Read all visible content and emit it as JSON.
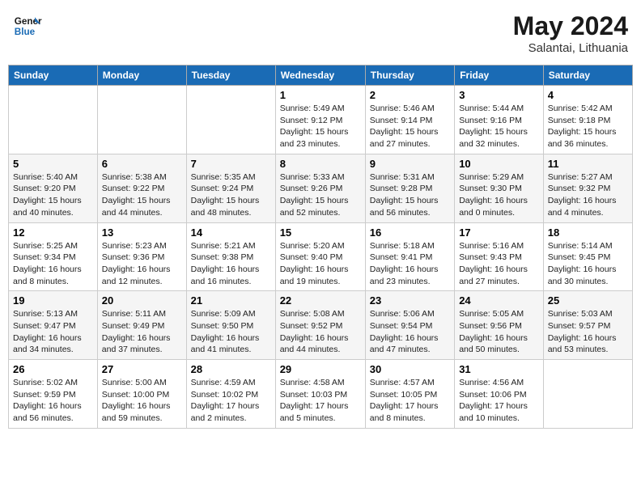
{
  "logo": {
    "line1": "General",
    "line2": "Blue"
  },
  "title": "May 2024",
  "location": "Salantai, Lithuania",
  "days_header": [
    "Sunday",
    "Monday",
    "Tuesday",
    "Wednesday",
    "Thursday",
    "Friday",
    "Saturday"
  ],
  "weeks": [
    [
      {
        "day": "",
        "info": ""
      },
      {
        "day": "",
        "info": ""
      },
      {
        "day": "",
        "info": ""
      },
      {
        "day": "1",
        "info": "Sunrise: 5:49 AM\nSunset: 9:12 PM\nDaylight: 15 hours\nand 23 minutes."
      },
      {
        "day": "2",
        "info": "Sunrise: 5:46 AM\nSunset: 9:14 PM\nDaylight: 15 hours\nand 27 minutes."
      },
      {
        "day": "3",
        "info": "Sunrise: 5:44 AM\nSunset: 9:16 PM\nDaylight: 15 hours\nand 32 minutes."
      },
      {
        "day": "4",
        "info": "Sunrise: 5:42 AM\nSunset: 9:18 PM\nDaylight: 15 hours\nand 36 minutes."
      }
    ],
    [
      {
        "day": "5",
        "info": "Sunrise: 5:40 AM\nSunset: 9:20 PM\nDaylight: 15 hours\nand 40 minutes."
      },
      {
        "day": "6",
        "info": "Sunrise: 5:38 AM\nSunset: 9:22 PM\nDaylight: 15 hours\nand 44 minutes."
      },
      {
        "day": "7",
        "info": "Sunrise: 5:35 AM\nSunset: 9:24 PM\nDaylight: 15 hours\nand 48 minutes."
      },
      {
        "day": "8",
        "info": "Sunrise: 5:33 AM\nSunset: 9:26 PM\nDaylight: 15 hours\nand 52 minutes."
      },
      {
        "day": "9",
        "info": "Sunrise: 5:31 AM\nSunset: 9:28 PM\nDaylight: 15 hours\nand 56 minutes."
      },
      {
        "day": "10",
        "info": "Sunrise: 5:29 AM\nSunset: 9:30 PM\nDaylight: 16 hours\nand 0 minutes."
      },
      {
        "day": "11",
        "info": "Sunrise: 5:27 AM\nSunset: 9:32 PM\nDaylight: 16 hours\nand 4 minutes."
      }
    ],
    [
      {
        "day": "12",
        "info": "Sunrise: 5:25 AM\nSunset: 9:34 PM\nDaylight: 16 hours\nand 8 minutes."
      },
      {
        "day": "13",
        "info": "Sunrise: 5:23 AM\nSunset: 9:36 PM\nDaylight: 16 hours\nand 12 minutes."
      },
      {
        "day": "14",
        "info": "Sunrise: 5:21 AM\nSunset: 9:38 PM\nDaylight: 16 hours\nand 16 minutes."
      },
      {
        "day": "15",
        "info": "Sunrise: 5:20 AM\nSunset: 9:40 PM\nDaylight: 16 hours\nand 19 minutes."
      },
      {
        "day": "16",
        "info": "Sunrise: 5:18 AM\nSunset: 9:41 PM\nDaylight: 16 hours\nand 23 minutes."
      },
      {
        "day": "17",
        "info": "Sunrise: 5:16 AM\nSunset: 9:43 PM\nDaylight: 16 hours\nand 27 minutes."
      },
      {
        "day": "18",
        "info": "Sunrise: 5:14 AM\nSunset: 9:45 PM\nDaylight: 16 hours\nand 30 minutes."
      }
    ],
    [
      {
        "day": "19",
        "info": "Sunrise: 5:13 AM\nSunset: 9:47 PM\nDaylight: 16 hours\nand 34 minutes."
      },
      {
        "day": "20",
        "info": "Sunrise: 5:11 AM\nSunset: 9:49 PM\nDaylight: 16 hours\nand 37 minutes."
      },
      {
        "day": "21",
        "info": "Sunrise: 5:09 AM\nSunset: 9:50 PM\nDaylight: 16 hours\nand 41 minutes."
      },
      {
        "day": "22",
        "info": "Sunrise: 5:08 AM\nSunset: 9:52 PM\nDaylight: 16 hours\nand 44 minutes."
      },
      {
        "day": "23",
        "info": "Sunrise: 5:06 AM\nSunset: 9:54 PM\nDaylight: 16 hours\nand 47 minutes."
      },
      {
        "day": "24",
        "info": "Sunrise: 5:05 AM\nSunset: 9:56 PM\nDaylight: 16 hours\nand 50 minutes."
      },
      {
        "day": "25",
        "info": "Sunrise: 5:03 AM\nSunset: 9:57 PM\nDaylight: 16 hours\nand 53 minutes."
      }
    ],
    [
      {
        "day": "26",
        "info": "Sunrise: 5:02 AM\nSunset: 9:59 PM\nDaylight: 16 hours\nand 56 minutes."
      },
      {
        "day": "27",
        "info": "Sunrise: 5:00 AM\nSunset: 10:00 PM\nDaylight: 16 hours\nand 59 minutes."
      },
      {
        "day": "28",
        "info": "Sunrise: 4:59 AM\nSunset: 10:02 PM\nDaylight: 17 hours\nand 2 minutes."
      },
      {
        "day": "29",
        "info": "Sunrise: 4:58 AM\nSunset: 10:03 PM\nDaylight: 17 hours\nand 5 minutes."
      },
      {
        "day": "30",
        "info": "Sunrise: 4:57 AM\nSunset: 10:05 PM\nDaylight: 17 hours\nand 8 minutes."
      },
      {
        "day": "31",
        "info": "Sunrise: 4:56 AM\nSunset: 10:06 PM\nDaylight: 17 hours\nand 10 minutes."
      },
      {
        "day": "",
        "info": ""
      }
    ]
  ]
}
